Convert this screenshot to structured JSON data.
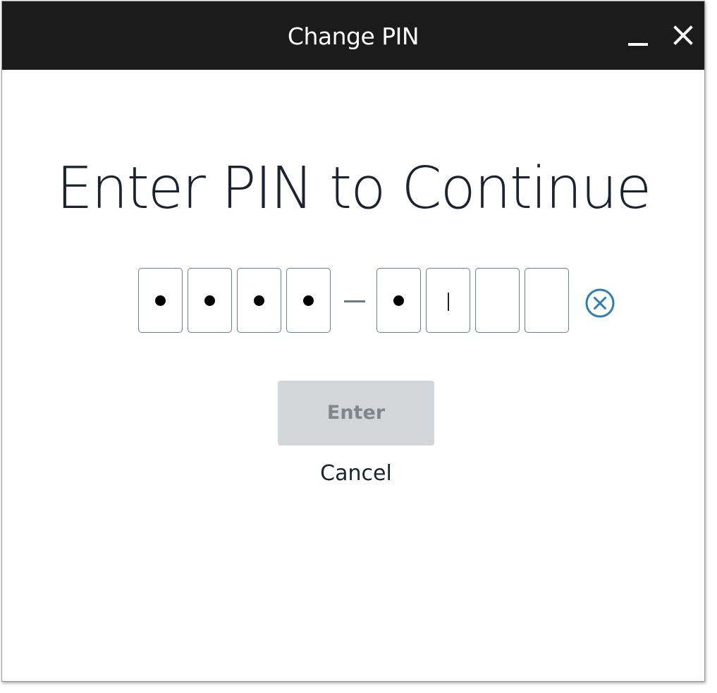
{
  "window": {
    "title": "Change PIN",
    "minimize_icon": "minimize-icon",
    "close_icon": "close-icon"
  },
  "main": {
    "heading": "Enter PIN to Continue",
    "pin": {
      "first_group": [
        {
          "filled": true
        },
        {
          "filled": true
        },
        {
          "filled": true
        },
        {
          "filled": true
        }
      ],
      "second_group": [
        {
          "filled": true
        },
        {
          "filled": false,
          "focused": true
        },
        {
          "filled": false
        },
        {
          "filled": false
        }
      ],
      "separator": "–",
      "clear_icon": "clear-circle-x-icon"
    },
    "enter_label": "Enter",
    "cancel_label": "Cancel"
  },
  "colors": {
    "titlebar": "#1b1b1b",
    "accent": "#2b7fb6",
    "button_disabled_bg": "#d3d6d9",
    "button_disabled_text": "#80868d"
  }
}
